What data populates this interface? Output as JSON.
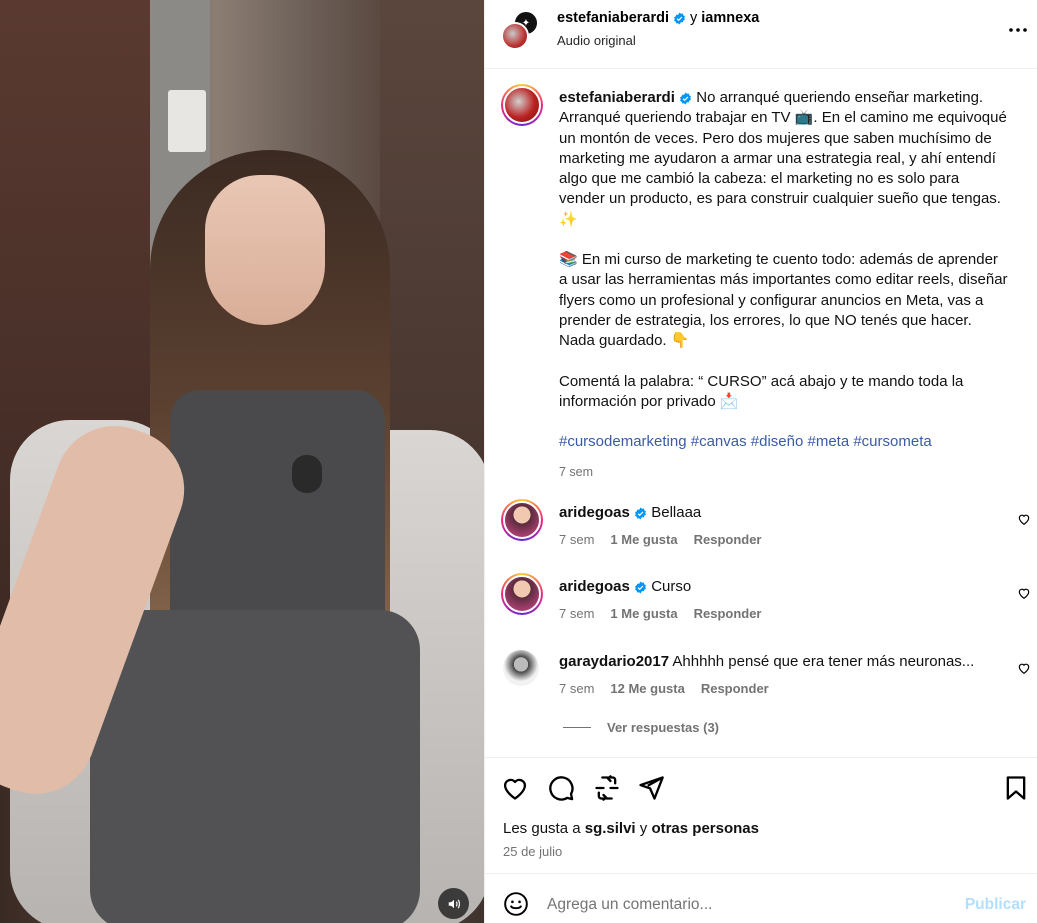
{
  "header": {
    "user1": "estefaniaberardi",
    "connector": "y",
    "user2": "iamnexa",
    "subtitle": "Audio original"
  },
  "caption": {
    "user": "estefaniaberardi",
    "para1": "No arranqué queriendo enseñar marketing. Arranqué queriendo trabajar en TV 📺. En el camino me equivoqué un montón de veces. Pero dos mujeres que saben muchísimo de marketing me ayudaron a armar una estrategia real, y ahí entendí algo que me cambió la cabeza: el marketing no es solo para vender un producto, es para construir cualquier sueño que tengas. ✨",
    "para2": "📚 En mi curso de marketing te cuento todo: además de aprender a usar las herramientas más importantes como editar reels, diseñar flyers como un profesional y configurar anuncios en Meta, vas a prender de estrategia, los errores, lo que NO tenés que hacer. Nada guardado. 👇",
    "para3": "Comentá la palabra: “ CURSO” acá abajo y te mando toda la información por privado 📩",
    "tags": "#cursodemarketing #canvas #diseño #meta #cursometa",
    "time": "7 sem"
  },
  "comments": [
    {
      "user": "aridegoas",
      "verified": true,
      "text": "Bellaaa",
      "time": "7 sem",
      "likes": "1 Me gusta",
      "reply": "Responder"
    },
    {
      "user": "aridegoas",
      "verified": true,
      "text": "Curso",
      "time": "7 sem",
      "likes": "1 Me gusta",
      "reply": "Responder"
    },
    {
      "user": "garaydario2017",
      "verified": false,
      "text": "Ahhhhh pensé que era tener más neuronas...",
      "time": "7 sem",
      "likes": "12 Me gusta",
      "reply": "Responder"
    }
  ],
  "replies_label": "Ver respuestas (3)",
  "likes": {
    "prefix": "Les gusta a",
    "user": "sg.silvi",
    "mid": "y",
    "others": "otras personas"
  },
  "date": "25 de julio",
  "add_comment": {
    "placeholder": "Agrega un comentario...",
    "publish": "Publicar"
  },
  "colors": {
    "verified": "#0095f6",
    "hashtag": "#3a5ba5",
    "publish_disabled": "#b2dffc",
    "muted": "#737373"
  },
  "icons": [
    "more-icon",
    "verified-icon",
    "heart-icon",
    "comment-icon",
    "share-icon",
    "send-icon",
    "bookmark-icon",
    "emoji-icon",
    "speaker-icon"
  ]
}
